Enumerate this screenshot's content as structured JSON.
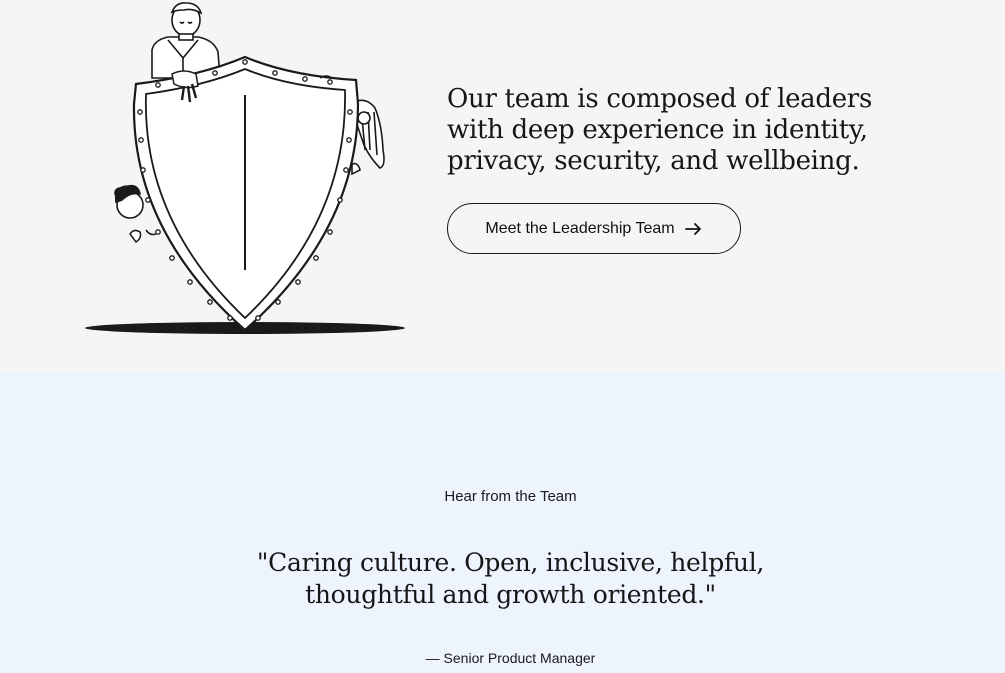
{
  "team_intro": {
    "headline_lines": [
      "Our team is composed of leaders",
      "with deep experience in identity,",
      "privacy, security, and wellbeing."
    ],
    "cta_label": "Meet the Leadership Team",
    "cta_icon": "arrow-right-icon",
    "illustration_icon": "shield-illustration"
  },
  "testimonial": {
    "eyebrow": "Hear from the Team",
    "quote_lines": [
      "\"Caring culture. Open, inclusive, helpful,",
      "thoughtful and growth oriented.\""
    ],
    "attribution": "— Senior Product Manager"
  },
  "colors": {
    "top_background": "#f5f5f5",
    "bottom_background": "#edf4fe",
    "text": "#111111"
  }
}
